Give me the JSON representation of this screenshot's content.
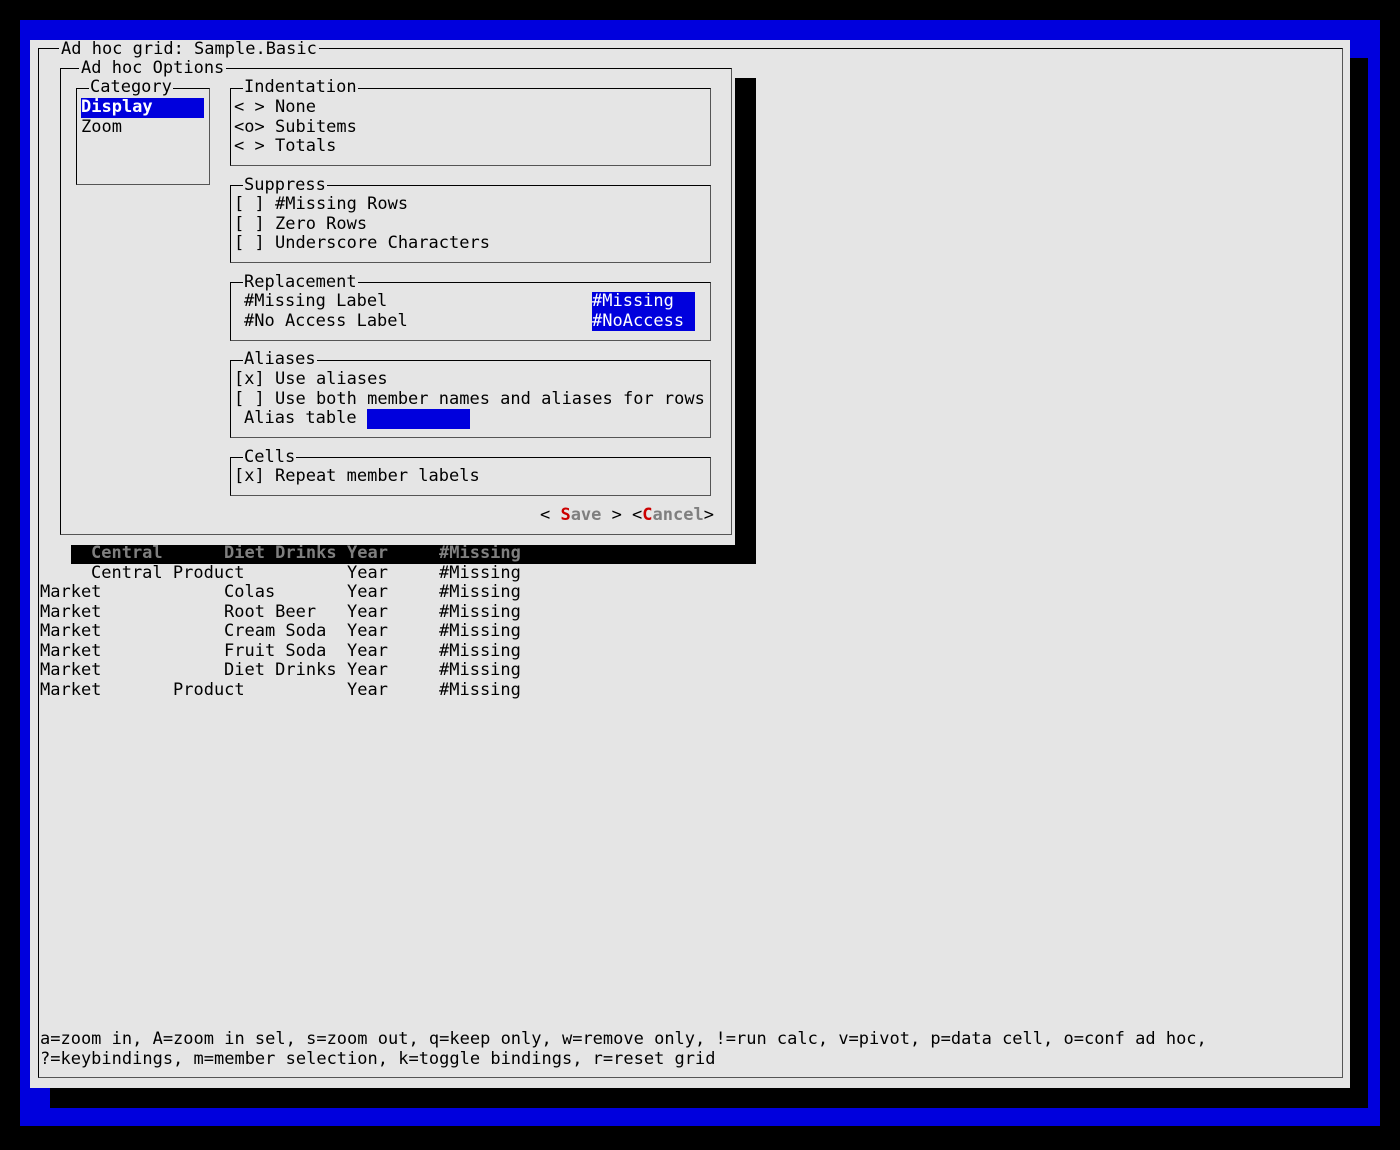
{
  "window": {
    "title": "Ad hoc grid: Sample.Basic"
  },
  "dialog": {
    "title": "Ad hoc Options",
    "category": {
      "label": "Category",
      "items": [
        "Display",
        "Zoom"
      ]
    },
    "indentation": {
      "label": "Indentation",
      "options": [
        {
          "mark": "< >",
          "label": "None"
        },
        {
          "mark": "<o>",
          "label": "Subitems"
        },
        {
          "mark": "< >",
          "label": "Totals"
        }
      ]
    },
    "suppress": {
      "label": "Suppress",
      "options": [
        {
          "mark": "[ ]",
          "label": "#Missing Rows"
        },
        {
          "mark": "[ ]",
          "label": "Zero Rows"
        },
        {
          "mark": "[ ]",
          "label": "Underscore Characters"
        }
      ]
    },
    "replacement": {
      "label": "Replacement",
      "missing_label": "#Missing Label",
      "missing_value": "#Missing",
      "noaccess_label": "#No Access Label",
      "noaccess_value": "#NoAccess"
    },
    "aliases": {
      "label": "Aliases",
      "use_aliases_mark": "[x]",
      "use_aliases": "Use aliases",
      "use_both_mark": "[ ]",
      "use_both": "Use both member names and aliases for rows",
      "alias_table_label": "Alias table",
      "alias_table_value": ""
    },
    "cells": {
      "label": "Cells",
      "repeat_mark": "[x]",
      "repeat": "Repeat member labels"
    },
    "buttons": {
      "save_open": "< ",
      "save_hot": "S",
      "save_rest": "ave",
      "save_close": " >",
      "cancel_open": "<",
      "cancel_hot": "C",
      "cancel_rest": "ancel",
      "cancel_close": ">"
    }
  },
  "grid": {
    "rows": [
      [
        "",
        "Central",
        "Diet Drinks",
        "Year",
        "#Missing"
      ],
      [
        "",
        "Central Product",
        "",
        "Year",
        "#Missing"
      ],
      [
        "Market",
        "",
        "Colas",
        "Year",
        "#Missing"
      ],
      [
        "Market",
        "",
        "Root Beer",
        "Year",
        "#Missing"
      ],
      [
        "Market",
        "",
        "Cream Soda",
        "Year",
        "#Missing"
      ],
      [
        "Market",
        "",
        "Fruit Soda",
        "Year",
        "#Missing"
      ],
      [
        "Market",
        "",
        "Diet Drinks",
        "Year",
        "#Missing"
      ],
      [
        "Market",
        "Product",
        "",
        "Year",
        "#Missing"
      ]
    ]
  },
  "help": {
    "line1": "a=zoom in, A=zoom in sel, s=zoom out, q=keep only, w=remove only, !=run calc, v=pivot, p=data cell, o=conf ad hoc,",
    "line2": "?=keybindings, m=member selection, k=toggle bindings, r=reset grid"
  },
  "colors": {
    "background": "#e5e5e5",
    "highlight": "#0000dd",
    "hotkey": "#cc0000"
  }
}
